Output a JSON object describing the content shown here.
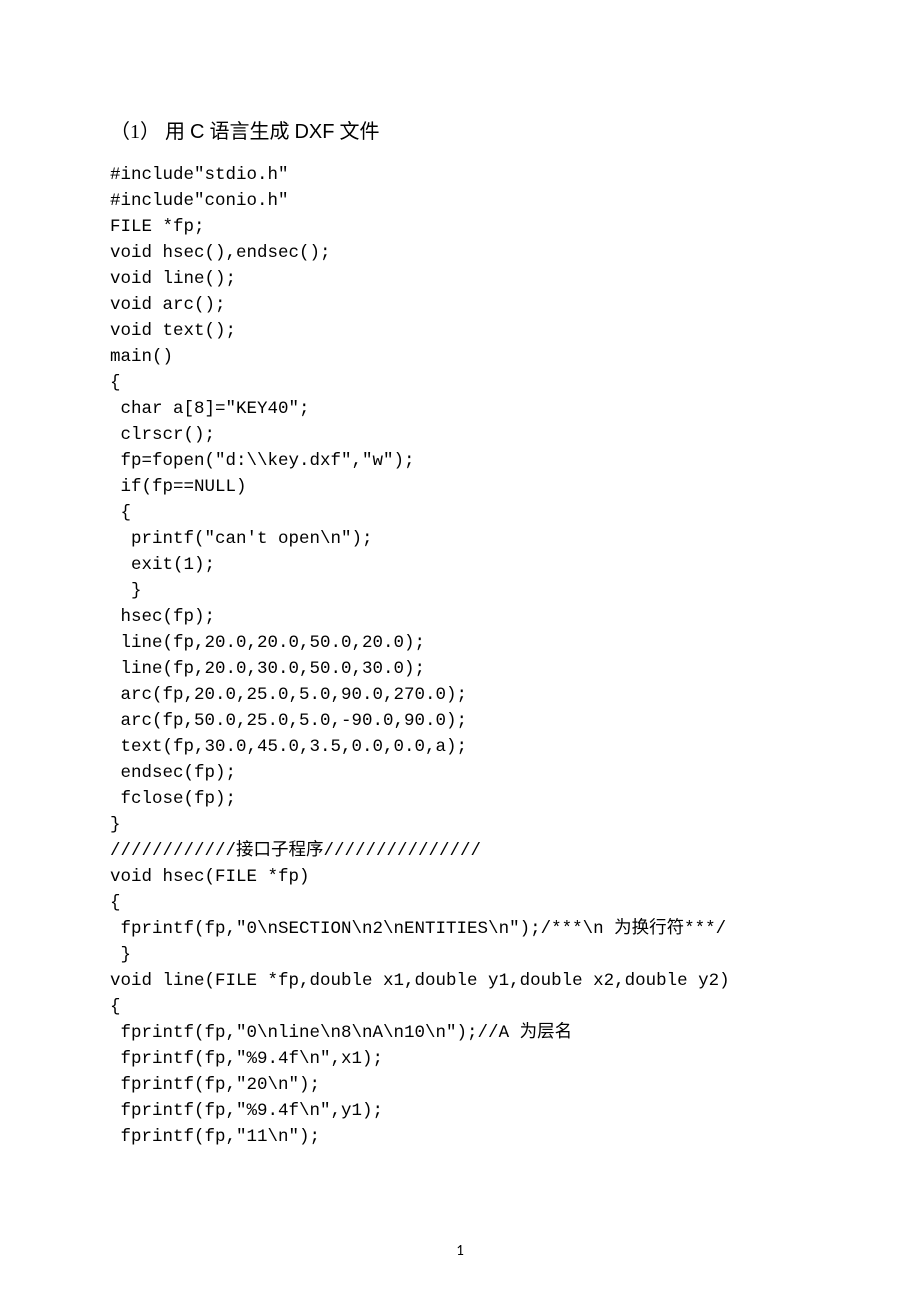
{
  "heading": {
    "prefix": "（1）",
    "gap": "    ",
    "text_cn1": "用 ",
    "text_en1": "C",
    "text_cn2": " 语言生成 ",
    "text_en2": "DXF",
    "text_cn3": " 文件"
  },
  "code": "#include\"stdio.h\"\n#include\"conio.h\"\nFILE *fp;\nvoid hsec(),endsec();\nvoid line();\nvoid arc();\nvoid text();\nmain()\n{\n char a[8]=\"KEY40\";\n clrscr();\n fp=fopen(\"d:\\\\key.dxf\",\"w\");\n if(fp==NULL)\n {\n  printf(\"can't open\\n\");\n  exit(1);\n  }\n hsec(fp);\n line(fp,20.0,20.0,50.0,20.0);\n line(fp,20.0,30.0,50.0,30.0);\n arc(fp,20.0,25.0,5.0,90.0,270.0);\n arc(fp,50.0,25.0,5.0,-90.0,90.0);\n text(fp,30.0,45.0,3.5,0.0,0.0,a);\n endsec(fp);\n fclose(fp);\n}\n////////////接口子程序///////////////\nvoid hsec(FILE *fp)\n{\n fprintf(fp,\"0\\nSECTION\\n2\\nENTITIES\\n\");/***\\n 为换行符***/\n }\nvoid line(FILE *fp,double x1,double y1,double x2,double y2)\n{\n fprintf(fp,\"0\\nline\\n8\\nA\\n10\\n\");//A 为层名\n fprintf(fp,\"%9.4f\\n\",x1);\n fprintf(fp,\"20\\n\");\n fprintf(fp,\"%9.4f\\n\",y1);\n fprintf(fp,\"11\\n\");",
  "page_number": "1"
}
